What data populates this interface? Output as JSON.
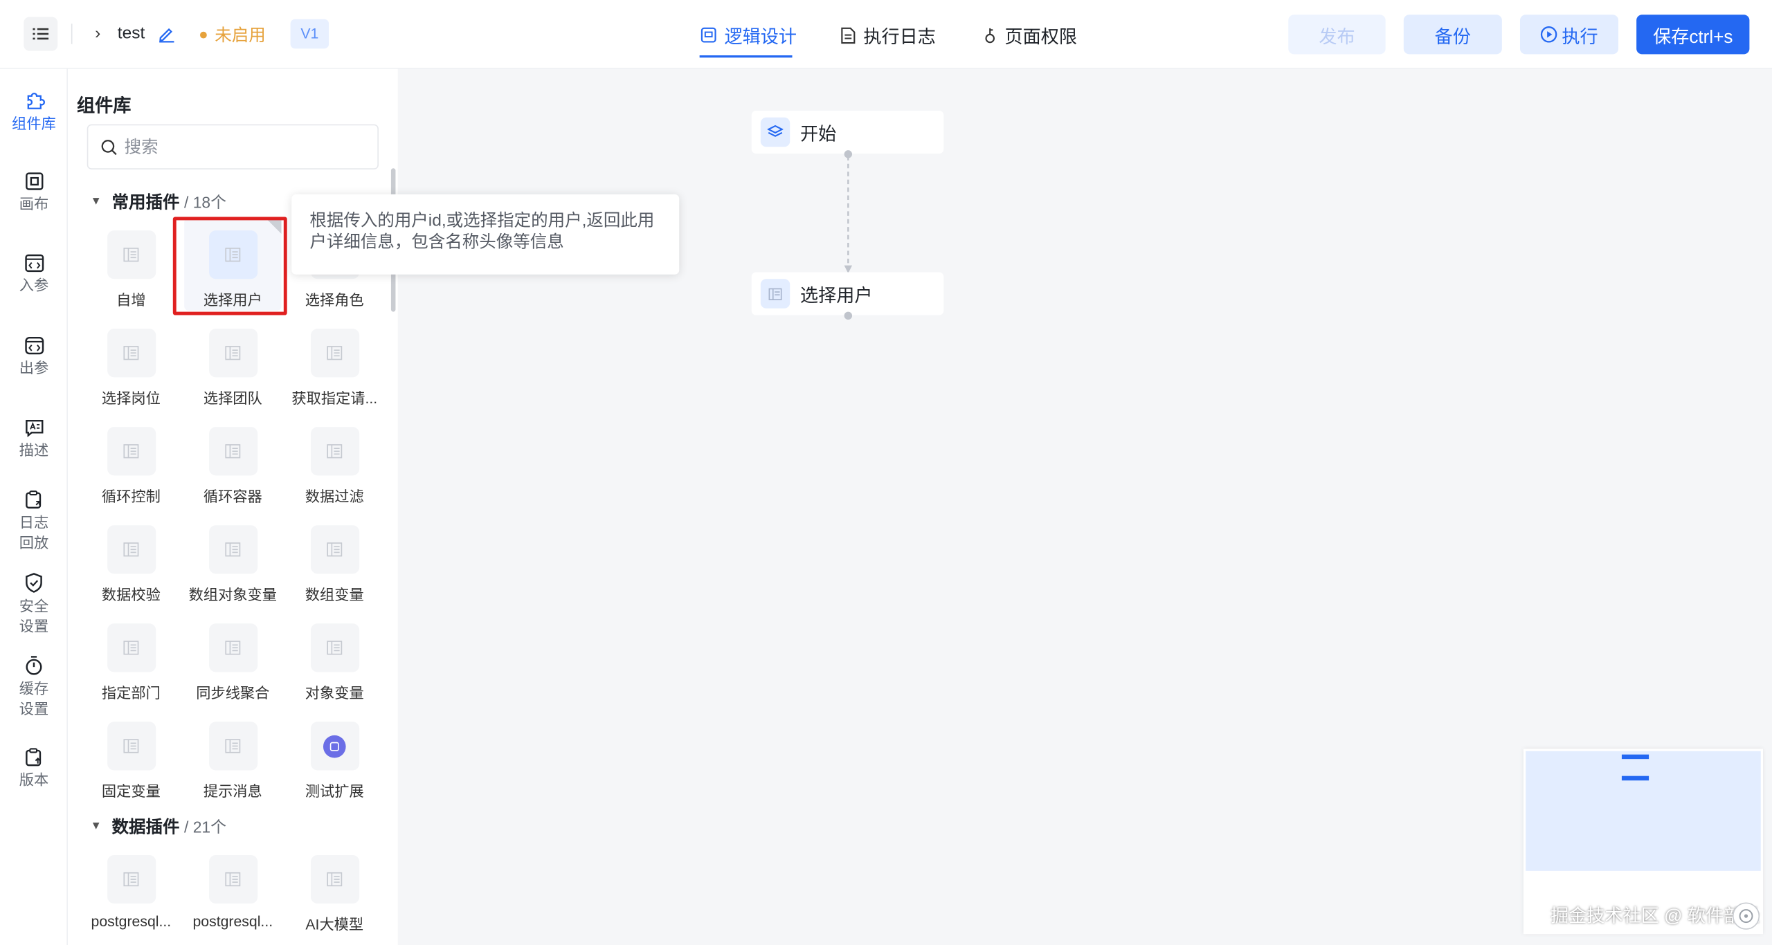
{
  "header": {
    "app_name": "test",
    "status": "未启用",
    "version": "V1",
    "tabs": [
      {
        "label": "逻辑设计",
        "active": true
      },
      {
        "label": "执行日志",
        "active": false
      },
      {
        "label": "页面权限",
        "active": false
      }
    ],
    "buttons": {
      "publish": "发布",
      "backup": "备份",
      "run": "执行",
      "save": "保存ctrl+s"
    }
  },
  "rail": {
    "items": [
      "组件库",
      "画布",
      "入参",
      "出参",
      "描述",
      "日志\n回放",
      "安全\n设置",
      "缓存\n设置",
      "版本"
    ]
  },
  "library": {
    "title": "组件库",
    "search_placeholder": "搜索",
    "groups": [
      {
        "name": "常用插件",
        "count": "/ 18个",
        "items": [
          "自增",
          "选择用户",
          "选择角色",
          "选择岗位",
          "选择团队",
          "获取指定请...",
          "循环控制",
          "循环容器",
          "数据过滤",
          "数据校验",
          "数组对象变量",
          "数组变量",
          "指定部门",
          "同步线聚合",
          "对象变量",
          "固定变量",
          "提示消息",
          "测试扩展"
        ]
      },
      {
        "name": "数据插件",
        "count": "/ 21个",
        "items": [
          "postgresql...",
          "postgresql...",
          "AI大模型"
        ]
      }
    ],
    "selected_item": "选择用户",
    "tooltip": "根据传入的用户id,或选择指定的用户,返回此用户详细信息，包含名称头像等信息"
  },
  "canvas": {
    "nodes": [
      {
        "label": "开始",
        "icon": "layers-icon"
      },
      {
        "label": "选择用户",
        "icon": "component-icon"
      }
    ]
  },
  "watermark": "掘金技术社区 @ 软件部长",
  "colors": {
    "primary": "#2468f2",
    "status_warning": "#e6a23c",
    "highlight": "#e02020"
  }
}
